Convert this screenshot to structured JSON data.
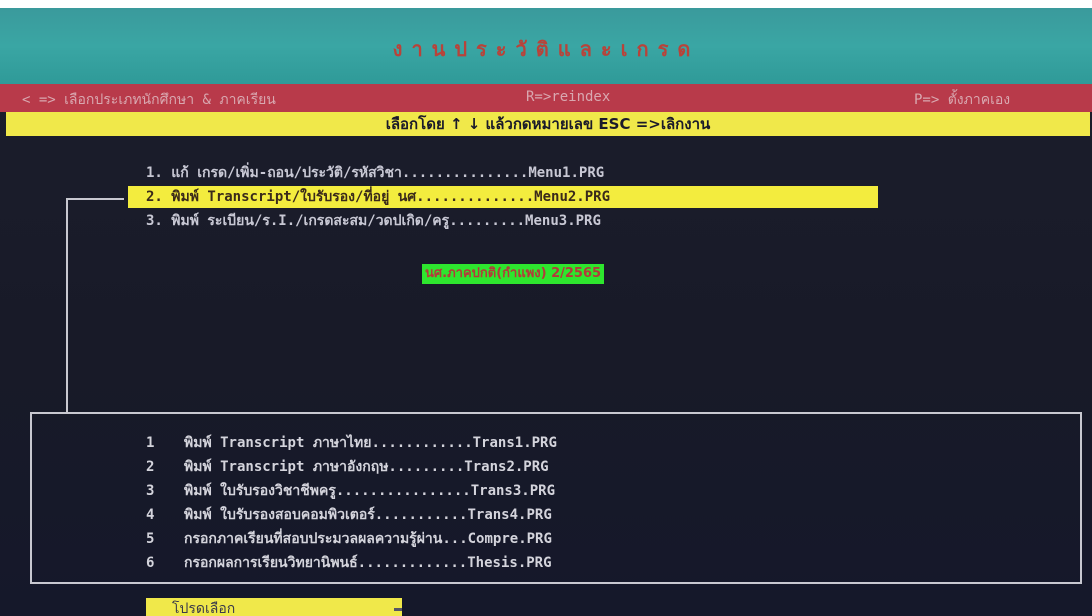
{
  "header": {
    "title": "งานประวัติและเกรด"
  },
  "status_bar": {
    "left": "< => เลือกประเภทนักศึกษา & ภาคเรียน",
    "middle": "R=>reindex",
    "right": "P=> ตั้งภาคเอง"
  },
  "instruction_bar": {
    "text": "เลือกโดย ↑ ↓ แล้วกดหมายเลข ESC =>เลิกงาน"
  },
  "main_menu": {
    "items": [
      {
        "label": "1. แก้ เกรด/เพิ่ม-ถอน/ประวัติ/รหัสวิชา...............Menu1.PRG"
      },
      {
        "label": "2. พิมพ์ Transcript/ใบรับรอง/ที่อยู่ นศ..............Menu2.PRG"
      },
      {
        "label": "3. พิมพ์ ระเบียน/ร.I./เกรดสะสม/วดปเกิด/ครู.........Menu3.PRG"
      }
    ],
    "selected_index": 1
  },
  "term_badge": {
    "text": "นศ.ภาคปกติ(กำแพง) 2/2565"
  },
  "submenu": {
    "items": [
      {
        "num": "1",
        "label": "พิมพ์ Transcript ภาษาไทย............Trans1.PRG"
      },
      {
        "num": "2",
        "label": "พิมพ์ Transcript ภาษาอังกฤษ.........Trans2.PRG"
      },
      {
        "num": "3",
        "label": "พิมพ์ ใบรับรองวิชาชีพครู................Trans3.PRG"
      },
      {
        "num": "4",
        "label": "พิมพ์ ใบรับรองสอบคอมพิวเตอร์...........Trans4.PRG"
      },
      {
        "num": "5",
        "label": "กรอกภาคเรียนที่สอบประมวลผลความรู้ผ่าน...Compre.PRG"
      },
      {
        "num": "6",
        "label": "กรอกผลการเรียนวิทยานิพนธ์.............Thesis.PRG"
      }
    ]
  },
  "prompt": {
    "label": "โปรดเลือก"
  },
  "colors": {
    "title_bar": "#3aa6a4",
    "status_bar": "#b83a4a",
    "highlight": "#f3ec3e",
    "badge": "#2ee62e",
    "background": "#1a1c2a"
  }
}
